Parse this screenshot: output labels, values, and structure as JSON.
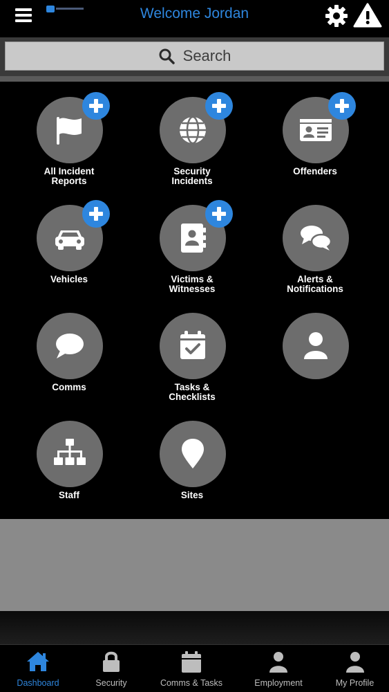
{
  "header": {
    "title": "Welcome Jordan",
    "menu_icon": "hamburger-menu-icon",
    "settings_icon": "gear-icon",
    "alert_icon": "warning-triangle-icon"
  },
  "search": {
    "placeholder": "Search",
    "icon": "search-icon"
  },
  "tiles": [
    {
      "label_line1": "All Incident",
      "label_line2": "Reports",
      "icon": "flag-icon",
      "has_add": true
    },
    {
      "label_line1": "Security",
      "label_line2": "Incidents",
      "icon": "globe-icon",
      "has_add": true
    },
    {
      "label_line1": "Offenders",
      "label_line2": "",
      "icon": "id-card-icon",
      "has_add": true
    },
    {
      "label_line1": "Vehicles",
      "label_line2": "",
      "icon": "car-icon",
      "has_add": true
    },
    {
      "label_line1": "Victims &",
      "label_line2": "Witnesses",
      "icon": "address-book-icon",
      "has_add": true
    },
    {
      "label_line1": "Alerts &",
      "label_line2": "Notifications",
      "icon": "chat-bubbles-icon",
      "has_add": false
    },
    {
      "label_line1": "Comms",
      "label_line2": "",
      "icon": "speech-bubble-icon",
      "has_add": false
    },
    {
      "label_line1": "Tasks &",
      "label_line2": "Checklists",
      "icon": "calendar-check-icon",
      "has_add": false
    },
    {
      "label_line1": "",
      "label_line2": "",
      "icon": "user-icon",
      "has_add": false
    },
    {
      "label_line1": "Staff",
      "label_line2": "",
      "icon": "org-chart-icon",
      "has_add": false
    },
    {
      "label_line1": "Sites",
      "label_line2": "",
      "icon": "map-pin-icon",
      "has_add": false
    }
  ],
  "bottom_nav": [
    {
      "label": "Dashboard",
      "icon": "home-icon",
      "active": true
    },
    {
      "label": "Security",
      "icon": "lock-icon",
      "active": false
    },
    {
      "label": "Comms & Tasks",
      "icon": "calendar-icon",
      "active": false
    },
    {
      "label": "Employment",
      "icon": "user-icon",
      "active": false
    },
    {
      "label": "My Profile",
      "icon": "user-icon",
      "active": false
    }
  ],
  "colors": {
    "accent": "#2e86de",
    "tile_circle": "#6d6d6d",
    "background": "#000000",
    "nav_inactive": "#bdbdbd"
  }
}
